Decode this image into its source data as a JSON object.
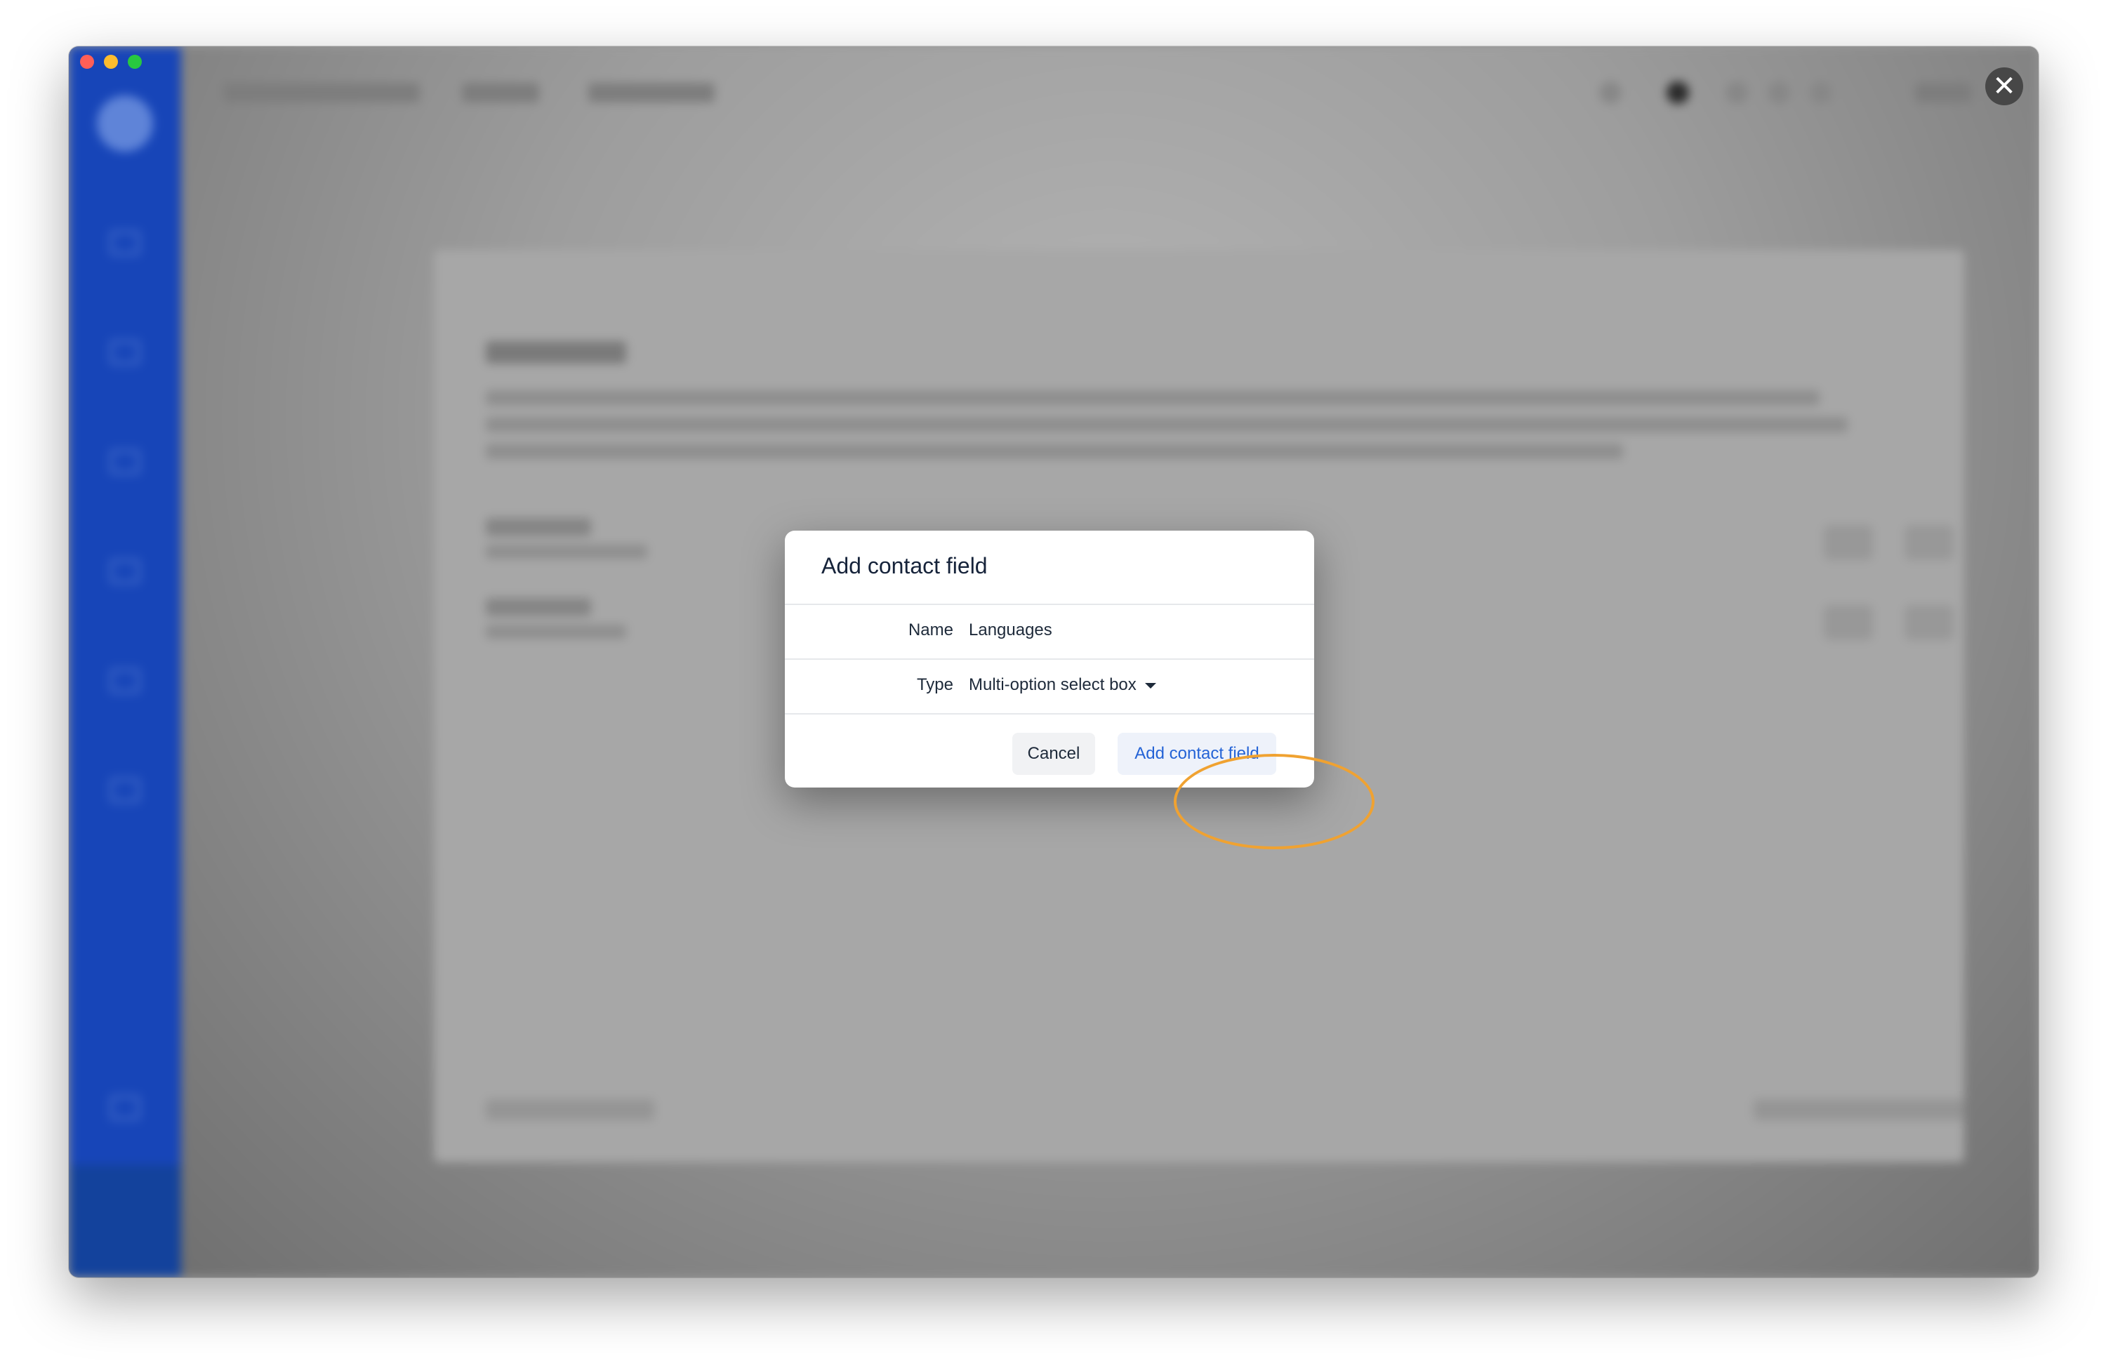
{
  "window": {
    "traffic_colors": [
      "#ff5f57",
      "#febc2e",
      "#28c840"
    ]
  },
  "close_button": {
    "symbol": "✕"
  },
  "modal": {
    "title": "Add contact field",
    "fields": [
      {
        "label": "Name",
        "value": "Languages"
      },
      {
        "label": "Type",
        "value": "Multi-option select box"
      }
    ],
    "cancel_label": "Cancel",
    "submit_label": "Add contact field"
  },
  "colors": {
    "sidebar": "#1745b8",
    "accent": "#2463d6",
    "highlight": "#f0a231"
  },
  "icons": {
    "close": "close-icon",
    "type_dropdown": "chevron-down-icon"
  }
}
